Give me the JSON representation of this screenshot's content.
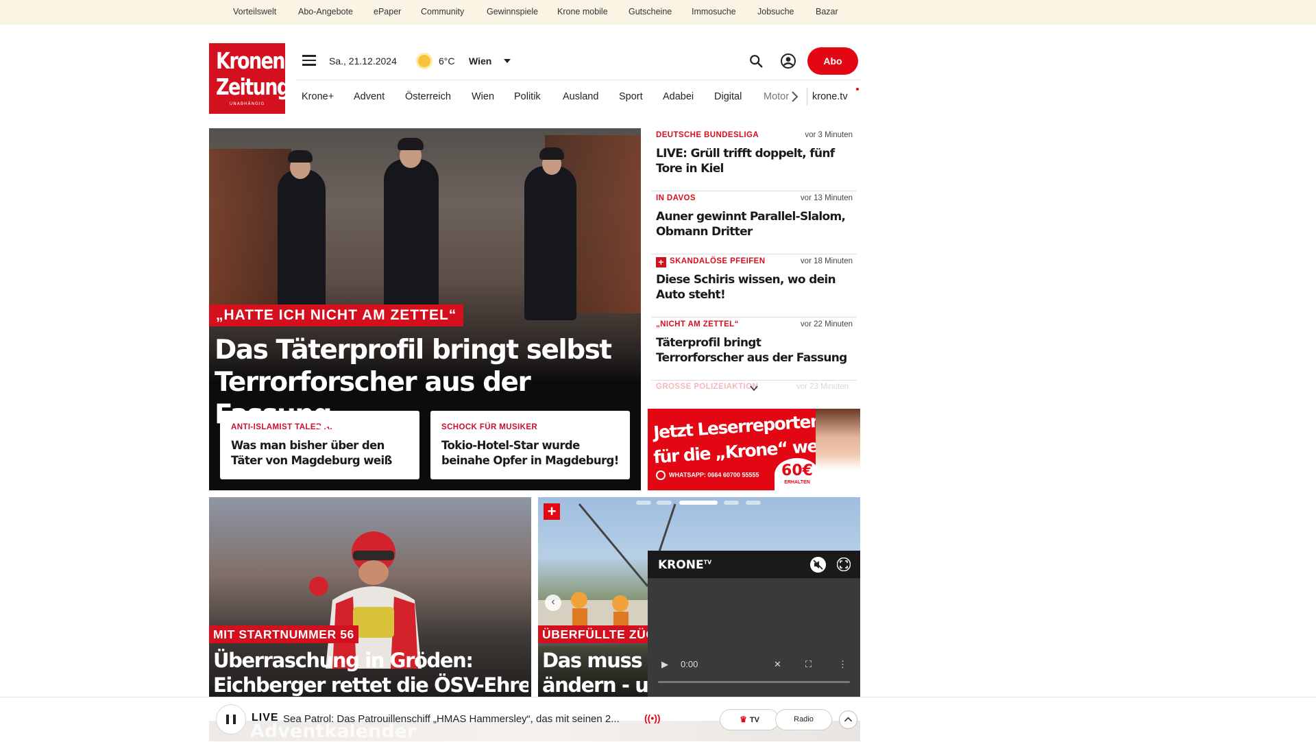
{
  "topbar": {
    "links": [
      "Vorteilswelt",
      "Abo-Angebote",
      "ePaper",
      "Community",
      "Gewinnspiele",
      "Krone mobile",
      "Gutscheine",
      "Immosuche",
      "Jobsuche",
      "Bazar"
    ]
  },
  "logo": {
    "line1": "Kronen",
    "line2": "Zeitung",
    "tagline": "UNABHÄNGIG"
  },
  "header": {
    "date": "Sa., 21.12.2024",
    "temperature": "6°C",
    "city": "Wien",
    "abo_label": "Abo"
  },
  "nav": {
    "items": [
      "Krone+",
      "Advent",
      "Österreich",
      "Wien",
      "Politik",
      "Ausland",
      "Sport",
      "Adabei",
      "Digital",
      "Motor"
    ],
    "tv_link": "krone.tv"
  },
  "hero": {
    "kicker": "„HATTE ICH NICHT AM ZETTEL“",
    "title": "Das Täterprofil bringt selbst Terrorforscher aus der Fassung",
    "cards": [
      {
        "kicker": "ANTI-ISLAMIST TALEB A.",
        "title": "Was man bisher über den Täter von Magdeburg weiß"
      },
      {
        "kicker": "SCHOCK FÜR MUSIKER",
        "title": "Tokio-Hotel-Star wurde beinahe Opfer in Magdeburg!"
      }
    ]
  },
  "ticker": {
    "items": [
      {
        "kicker": "DEUTSCHE BUNDESLIGA",
        "time": "vor 3 Minuten",
        "title": "LIVE: Grüll trifft doppelt, fünf Tore in Kiel",
        "plus": false
      },
      {
        "kicker": "IN DAVOS",
        "time": "vor 13 Minuten",
        "title": "Auner gewinnt Parallel-Slalom, Obmann Dritter",
        "plus": false
      },
      {
        "kicker": "SKANDALÖSE PFEIFEN",
        "time": "vor 18 Minuten",
        "title": "Diese Schiris wissen, wo dein Auto steht!",
        "plus": true
      },
      {
        "kicker": "„NICHT AM ZETTEL“",
        "time": "vor 22 Minuten",
        "title": "Täterprofil bringt Terrorforscher aus der Fassung",
        "plus": false
      }
    ],
    "faded_kicker": "GROSSE POLIZEIAKTION",
    "faded_time": "vor 23 Minuten"
  },
  "ad": {
    "line1": "Jetzt Leserreporter",
    "line2": "für die „Krone“ werden",
    "whatsapp": "WHATSAPP: 0664 60700 55555",
    "amount": "60€",
    "amount_sub": "ERHALTEN"
  },
  "stories": [
    {
      "kicker": "MIT STARTNUMMER 56",
      "title_line1": "Überraschung in Gröden:",
      "title_line2": "Eichberger rettet die ÖSV-Ehre"
    },
    {
      "kicker": "ÜBERFÜLLTE ZÜGE",
      "title_line1": "Das muss s",
      "title_line2": "ändern - u"
    }
  ],
  "video": {
    "brand": "KRONE",
    "brand_sup": "TV",
    "time": "0:00"
  },
  "live_bar": {
    "label": "LIVE",
    "text": "Sea Patrol: Das Patrouillenschiff „HMAS Hammersley“, das mit seinen 2...",
    "tv_label": "TV",
    "radio_label": "Radio",
    "background_text": "Adventkalender"
  },
  "colors": {
    "brand_red": "#e30613",
    "kicker_red": "#d4101e",
    "topbar_bg": "#fbf5e6"
  }
}
